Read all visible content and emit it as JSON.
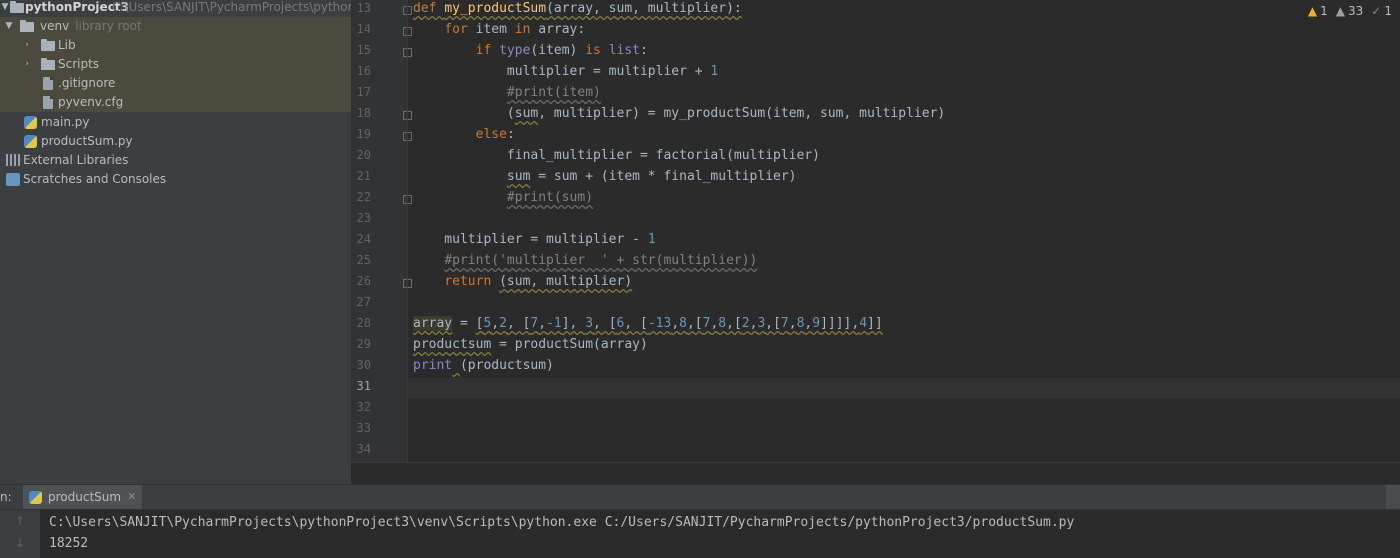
{
  "project_tree": {
    "root": {
      "name": "pythonProject3",
      "path": "C:\\Users\\SANJIT\\PycharmProjects\\pythonProje"
    },
    "items": [
      {
        "label": "venv",
        "hint": "library root",
        "icon": "folder-icon"
      },
      {
        "label": "Lib",
        "icon": "folder-icon"
      },
      {
        "label": "Scripts",
        "icon": "folder-icon"
      },
      {
        "label": ".gitignore",
        "icon": "file-icon"
      },
      {
        "label": "pyvenv.cfg",
        "icon": "file-icon"
      },
      {
        "label": "main.py",
        "icon": "python-file-icon"
      },
      {
        "label": "productSum.py",
        "icon": "python-file-icon"
      },
      {
        "label": "External Libraries",
        "icon": "library-icon"
      },
      {
        "label": "Scratches and Consoles",
        "icon": "scratch-icon"
      }
    ]
  },
  "editor": {
    "line_numbers": [
      "13",
      "14",
      "15",
      "16",
      "17",
      "18",
      "19",
      "20",
      "21",
      "22",
      "23",
      "24",
      "25",
      "26",
      "27",
      "28",
      "29",
      "30",
      "31",
      "32",
      "33",
      "34"
    ],
    "current_line": "31",
    "inspections": {
      "warnings": "1",
      "weak_warnings": "33",
      "ok": "1"
    }
  },
  "run_panel": {
    "label": "n:",
    "tab": "productSum",
    "output": [
      "C:\\Users\\SANJIT\\PycharmProjects\\pythonProject3\\venv\\Scripts\\python.exe C:/Users/SANJIT/PycharmProjects/pythonProject3/productSum.py",
      "18252"
    ]
  }
}
